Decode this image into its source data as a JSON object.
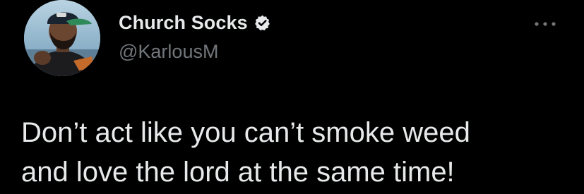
{
  "tweet": {
    "author": {
      "display_name": "Church Socks",
      "handle": "@KarlousM",
      "verified": true,
      "avatar_icon": "profile-photo"
    },
    "more_icon": "more-options-icon",
    "text": "Don’t act like you can’t smoke weed\nand love the lord at the same time!"
  },
  "colors": {
    "background": "#000000",
    "primary_text": "#e7e9ea",
    "secondary_text": "#71767b",
    "verified_badge": "#e7e9ea"
  }
}
